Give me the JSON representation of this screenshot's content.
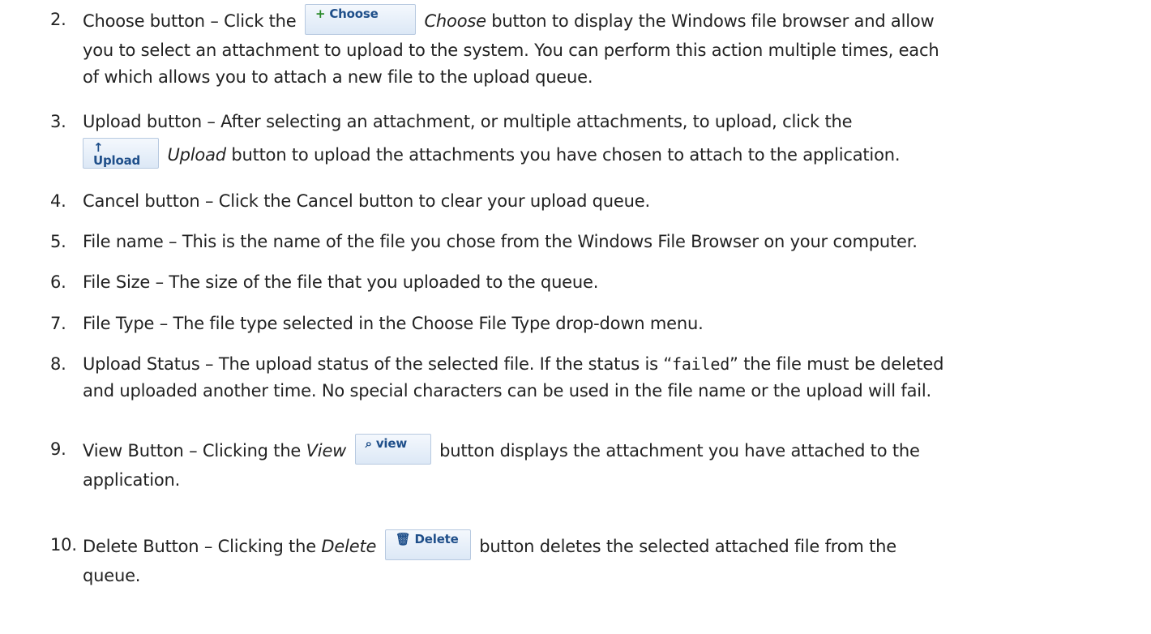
{
  "items": [
    {
      "num": "2.",
      "before": "Choose button – Click the",
      "italic": "Choose",
      "after": "button to display the Windows file browser and allow",
      "line2": "you to select an attachment to upload to the system. You can perform this action multiple times, each",
      "line3": "of which allows you to attach a new file to the upload queue."
    },
    {
      "num": "3.",
      "line1": "Upload button – After selecting an attachment, or multiple attachments, to upload, click the",
      "italic": "Upload",
      "after": "button to upload the attachments you have chosen to attach to the application."
    },
    {
      "num": "4.",
      "text": "Cancel button – Click the Cancel button to clear your upload queue."
    },
    {
      "num": "5.",
      "text": "File name – This is the name of the file you chose from the Windows File Browser on your computer."
    },
    {
      "num": "6.",
      "text": "File Size – The size of the file that you uploaded to the queue."
    },
    {
      "num": "7.",
      "text": "File Type – The file type selected in the Choose File Type drop-down menu."
    },
    {
      "num": "8.",
      "before": "Upload Status – The upload status of the selected file.  If the status is “",
      "mono": "failed",
      "after": "” the file must be deleted",
      "line2": "and uploaded another time.  No special characters can be used in the file name or the upload will fail."
    },
    {
      "num": "9.",
      "before": "View Button – Clicking the",
      "italic": "View",
      "after": "button displays the attachment you have attached to the",
      "line2": "application."
    },
    {
      "num": "10.",
      "before": "Delete Button – Clicking the",
      "italic": "Delete",
      "after": "button deletes the selected attached file from the",
      "line2": "queue."
    }
  ],
  "buttons": {
    "choose": {
      "icon": "plus-icon",
      "glyph": "+",
      "label": "Choose"
    },
    "upload": {
      "icon": "upload-arrow-icon",
      "glyph": "↑",
      "label": "Upload"
    },
    "view": {
      "icon": "magnifier-icon",
      "glyph": "⌕",
      "label": "view"
    },
    "delete": {
      "icon": "trash-icon",
      "glyph": "🗑",
      "label": "Delete"
    }
  },
  "colors": {
    "button_text": "#1f4f8a",
    "button_bg": "#dce8f6",
    "choose_icon": "#2a8a2a"
  }
}
